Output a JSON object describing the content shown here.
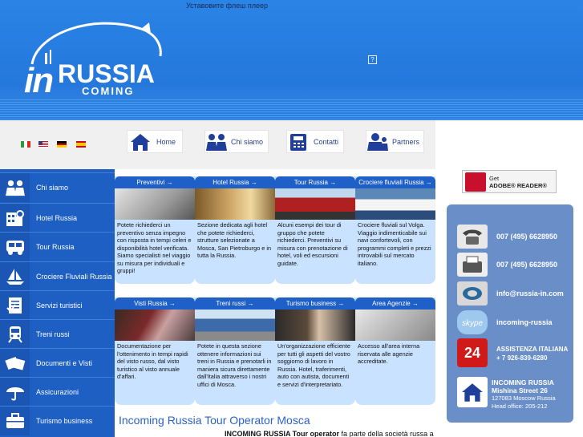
{
  "header": {
    "tagline": "Уставовите флеш плеер",
    "logo": {
      "in": "in",
      "russia": "RUSSIA",
      "coming": "COMING"
    },
    "help_icon": "?"
  },
  "nav": {
    "flags": [
      "flag-italy",
      "flag-uk",
      "flag-germany",
      "flag-spain"
    ],
    "items": [
      {
        "label": "Home",
        "icon": "house-icon"
      },
      {
        "label": "Chi siamo",
        "icon": "people-icon"
      },
      {
        "label": "Contatti",
        "icon": "phone-icon"
      },
      {
        "label": "Partners",
        "icon": "partners-icon"
      }
    ]
  },
  "sidebar": {
    "items": [
      {
        "label": "Chi siamo",
        "icon": "people-icon"
      },
      {
        "label": "Hotel Russia",
        "icon": "hotel-icon"
      },
      {
        "label": "Tour Russia",
        "icon": "bus-icon"
      },
      {
        "label": "Crociere Fluviali Russia",
        "icon": "boat-icon"
      },
      {
        "label": "Servizi turistici",
        "icon": "document-icon"
      },
      {
        "label": "Treni russi",
        "icon": "train-icon"
      },
      {
        "label": "Documenti e Visti",
        "icon": "passport-icon"
      },
      {
        "label": "Assicurazioni",
        "icon": "umbrella-icon"
      },
      {
        "label": "Turismo business",
        "icon": "briefcase-icon"
      }
    ]
  },
  "cards": [
    {
      "title": "Preventivi →",
      "text": "Potete richiederci un preventivo senza impegno con risposta in tempi celeri e disponibilità hotel verificata. Siamo specialisti nel viaggio su misura per individuali e gruppi!"
    },
    {
      "title": "Hotel Russia →",
      "text": "Sezione dedicata agli hotel che potete richiederci, strutture selezionate a Mosca, San Pietroburgo e in tutta la Russia."
    },
    {
      "title": "Tour Russia →",
      "text": "Alcuni esempi dei tour di gruppo che potete richiederci. Preventivi su misura con prenotazione di hotel, voli ed escursioni guidate."
    },
    {
      "title": "Crociere fluviali Russia →",
      "text": "Crociere fluviali sul Volga. Viaggio indimenticabile sui navi confortevoli, con programmi completi e prezzi introvabili sul mercato italiano."
    },
    {
      "title": "Visti Russia →",
      "text": "Documentazione per l'ottenimento in tempi rapidi del visto russo, dal visto turistico al visto annuale d'affari."
    },
    {
      "title": "Treni russi →",
      "text": "Potete in questa sezione ottenere informazioni sui treni in Russia e prenotarli in maniera sicura direttamente dall'Italia attraverso i nostri uffici di Mosca."
    },
    {
      "title": "Turismo business →",
      "text": "Un'organizzazione efficiente per tutti gli aspetti del vostro soggiorno di lavoro in Russia. Hotel, traferimenti, auto con autista, documenti e servizi d'interpretariato."
    },
    {
      "title": "Area Agenzie →",
      "text": "Accesso all'area interna riservata alle agenzie accreditate."
    }
  ],
  "main": {
    "title": "Incoming Russia Tour Operator Mosca",
    "intro_bold": "INCOMING RUSSIA Tour operator",
    "intro_rest": " fa parte della società russa a"
  },
  "adobe": {
    "line1": "Get",
    "line2": "ADOBE® READER®"
  },
  "contact": {
    "phone": "007 (495) 6628950",
    "fax": "007 (495) 6628950",
    "email": "info@russia-in.com",
    "skype": "incoming-russia",
    "assist_title": "ASSISTENZA ITALIANA",
    "assist_phone": "+ 7 926-839-6280",
    "badge": "24",
    "office_name": "INCOMING RUSSIA",
    "office_street": "Mishina Street 26",
    "office_city": "127083 Moscow Russia",
    "office_head": "Head office: 205-212"
  },
  "colors": {
    "header_blue": "#2577dc",
    "sidebar_blue": "#1e5fc4",
    "card_bg": "#c9e2ff",
    "contact_bg": "#6a8fc8"
  }
}
